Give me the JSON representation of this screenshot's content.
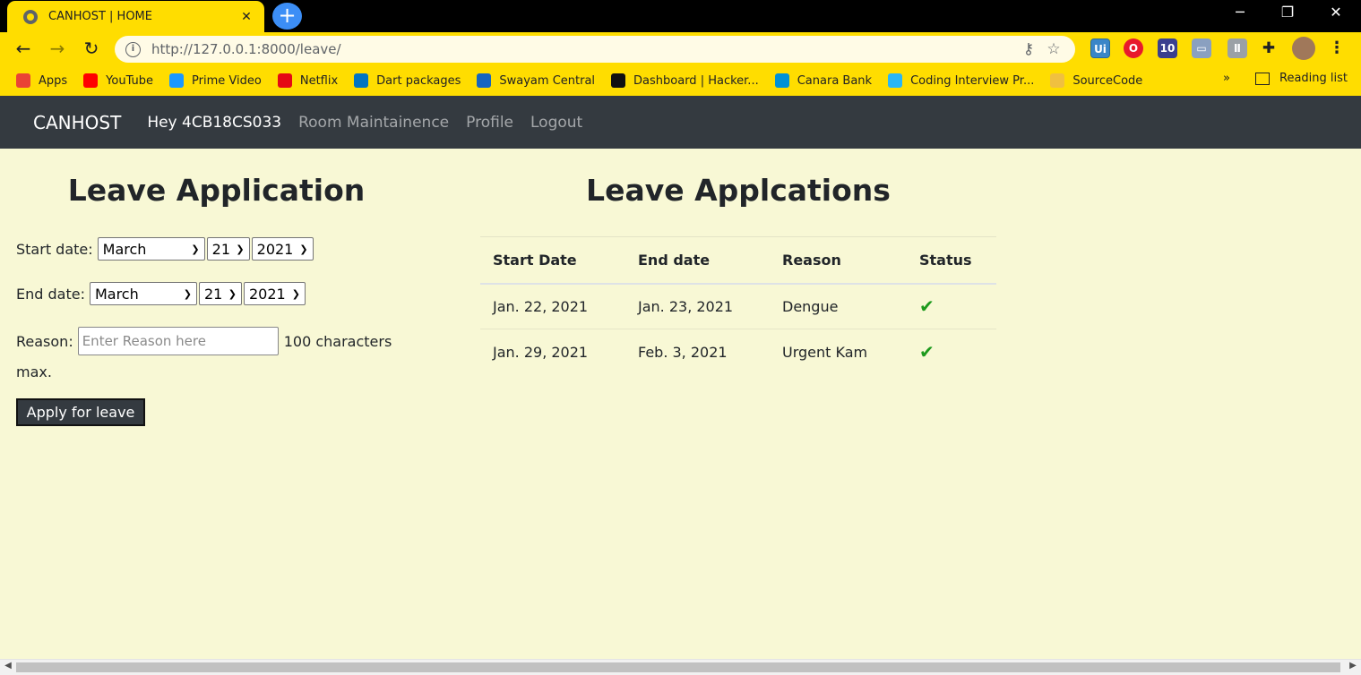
{
  "browser": {
    "tab_title": "CANHOST | HOME",
    "tab_close": "✕",
    "new_tab": "+",
    "url": "http://127.0.0.1:8000/leave/",
    "window_controls": [
      "─",
      "❐",
      "✕"
    ],
    "bookmarks": [
      {
        "label": "Apps",
        "icon": "apps-grid-icon",
        "color": "#ea4335"
      },
      {
        "label": "YouTube",
        "icon": "youtube-icon",
        "color": "#ff0000"
      },
      {
        "label": "Prime Video",
        "icon": "prime-video-icon",
        "color": "#1a98ff"
      },
      {
        "label": "Netflix",
        "icon": "netflix-icon",
        "color": "#e50914"
      },
      {
        "label": "Dart packages",
        "icon": "dart-icon",
        "color": "#0175c2"
      },
      {
        "label": "Swayam Central",
        "icon": "swayam-icon",
        "color": "#1565c0"
      },
      {
        "label": "Dashboard | Hacker...",
        "icon": "hackerrank-icon",
        "color": "#111111"
      },
      {
        "label": "Canara Bank",
        "icon": "canara-bank-icon",
        "color": "#0091d5"
      },
      {
        "label": "Coding Interview Pr...",
        "icon": "folder-icon",
        "color": "#29b6f6"
      },
      {
        "label": "SourceCode",
        "icon": "sourcecode-icon",
        "color": "#f0c040"
      }
    ],
    "bookmarks_more": "»",
    "reading_list": "Reading list"
  },
  "navbar": {
    "brand": "CANHOST",
    "greeting": "Hey 4CB18CS033",
    "links": [
      "Room Maintainence",
      "Profile",
      "Logout"
    ]
  },
  "form": {
    "heading": "Leave Application",
    "start_label": "Start date:",
    "start_month": "March",
    "start_day": "21",
    "start_year": "2021",
    "end_label": "End date:",
    "end_month": "March",
    "end_day": "21",
    "end_year": "2021",
    "reason_label": "Reason:",
    "reason_placeholder": "Enter Reason here",
    "reason_hint_line1": "100 characters",
    "reason_hint_line2": "max.",
    "submit_label": "Apply for leave"
  },
  "applications": {
    "heading": "Leave Applcations",
    "columns": [
      "Start Date",
      "End date",
      "Reason",
      "Status"
    ],
    "rows": [
      {
        "start": "Jan. 22, 2021",
        "end": "Jan. 23, 2021",
        "reason": "Dengue",
        "status": "approved"
      },
      {
        "start": "Jan. 29, 2021",
        "end": "Feb. 3, 2021",
        "reason": "Urgent Kam",
        "status": "approved"
      }
    ]
  }
}
